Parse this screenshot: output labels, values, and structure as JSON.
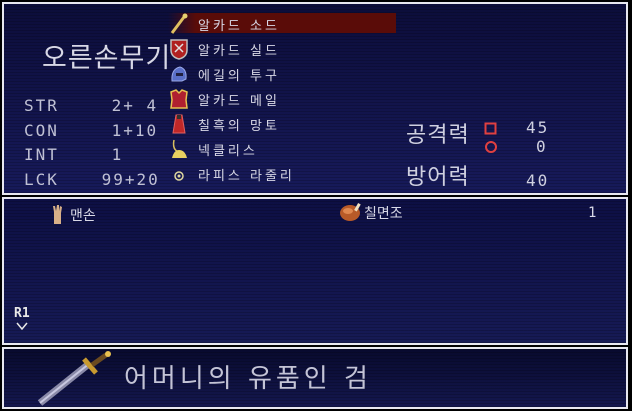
{
  "equipment_panel": {
    "slot_title": "오른손무기",
    "stats": [
      {
        "name": "STR",
        "value": "2+ 4"
      },
      {
        "name": "CON",
        "value": "1+10"
      },
      {
        "name": "INT",
        "value": "1"
      },
      {
        "name": "LCK",
        "value": "99+20"
      }
    ],
    "items": [
      {
        "label": "알카드 소드",
        "icon": "sword-icon",
        "selected": true
      },
      {
        "label": "알카드 실드",
        "icon": "shield-icon"
      },
      {
        "label": "에길의 투구",
        "icon": "helmet-icon"
      },
      {
        "label": "알카드 메일",
        "icon": "armor-icon"
      },
      {
        "label": "칠흑의 망토",
        "icon": "cloak-icon"
      },
      {
        "label": "넥클리스",
        "icon": "necklace-icon"
      },
      {
        "label": "라피스 라줄리",
        "icon": "gem-icon"
      }
    ],
    "attack_label": "공격력",
    "defense_label": "방어력",
    "attack_square_value": "45",
    "attack_circle_value": "0",
    "defense_value": "40",
    "square_color": "#e04040",
    "circle_color": "#e04040"
  },
  "inventory": {
    "items": [
      {
        "label": "맨손",
        "icon": "hand-icon",
        "count": ""
      },
      {
        "label": "칠면조",
        "icon": "turkey-icon",
        "count": "1"
      }
    ],
    "page_button": "R1"
  },
  "description": {
    "icon": "sword-icon",
    "text": "어머니의 유품인 검"
  }
}
